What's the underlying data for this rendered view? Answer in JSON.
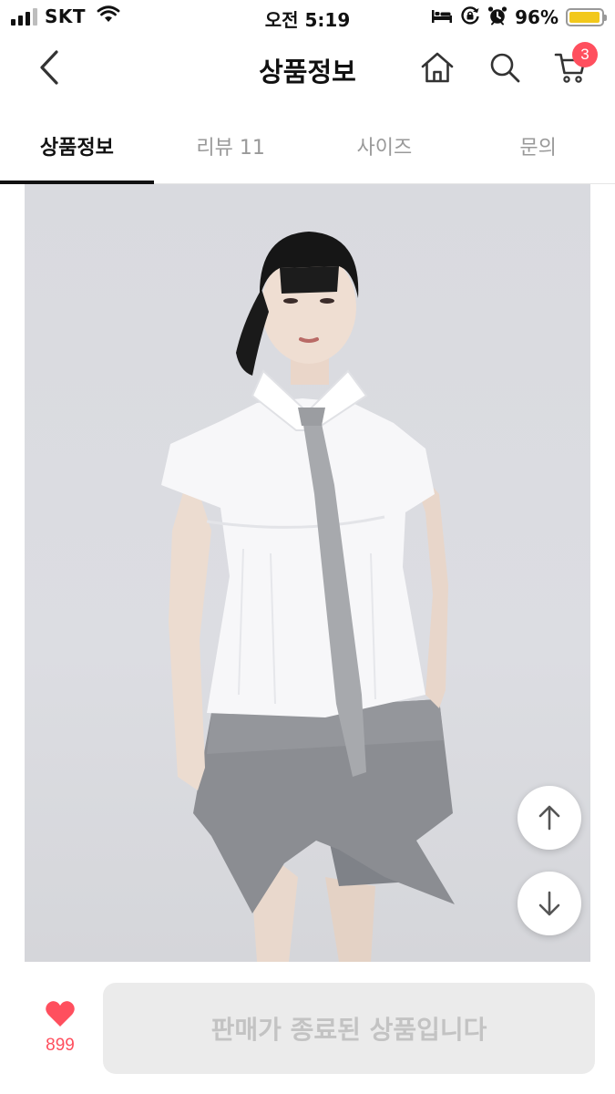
{
  "status_bar": {
    "carrier": "SKT",
    "time": "오전 5:19",
    "battery_percent": "96%",
    "battery_level": 0.96,
    "icons": [
      "signal-icon",
      "wifi-icon",
      "bed-icon",
      "rotation-lock-icon",
      "alarm-icon",
      "battery-icon"
    ]
  },
  "header": {
    "title": "상품정보",
    "cart_count": "3",
    "icons": [
      "back-icon",
      "home-icon",
      "search-icon",
      "cart-icon"
    ]
  },
  "tabs": [
    {
      "label": "상품정보",
      "active": true
    },
    {
      "label": "리뷰 11",
      "active": false
    },
    {
      "label": "사이즈",
      "active": false
    },
    {
      "label": "문의",
      "active": false
    }
  ],
  "product_image": {
    "icons": [
      "arrow-up-icon",
      "arrow-down-icon"
    ]
  },
  "bottom_bar": {
    "like_count": "899",
    "buy_button_label": "판매가 종료된 상품입니다",
    "buy_button_enabled": false
  },
  "colors": {
    "accent": "#ff4f5e",
    "battery": "#f2c81b",
    "disabled_button_bg": "#ebebeb",
    "disabled_button_text": "#c3c3c3",
    "inactive_tab": "#999999"
  }
}
